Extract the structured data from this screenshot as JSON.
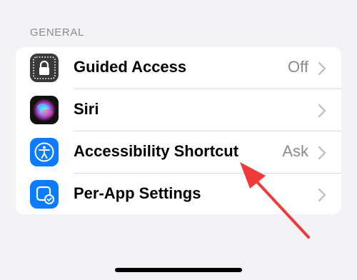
{
  "section": {
    "header": "GENERAL"
  },
  "rows": [
    {
      "label": "Guided Access",
      "value": "Off",
      "icon": "lock-icon",
      "icon_bg": "#3a3a3c"
    },
    {
      "label": "Siri",
      "value": "",
      "icon": "siri-icon",
      "icon_bg": "#1c1c1e"
    },
    {
      "label": "Accessibility Shortcut",
      "value": "Ask",
      "icon": "accessibility-icon",
      "icon_bg": "#0a7cff"
    },
    {
      "label": "Per-App Settings",
      "value": "",
      "icon": "per-app-settings-icon",
      "icon_bg": "#0a7cff"
    }
  ],
  "colors": {
    "background": "#f2f2f7",
    "card": "#ffffff",
    "secondary_text": "#8a8a8e",
    "annotation_arrow": "#f03a3a"
  }
}
